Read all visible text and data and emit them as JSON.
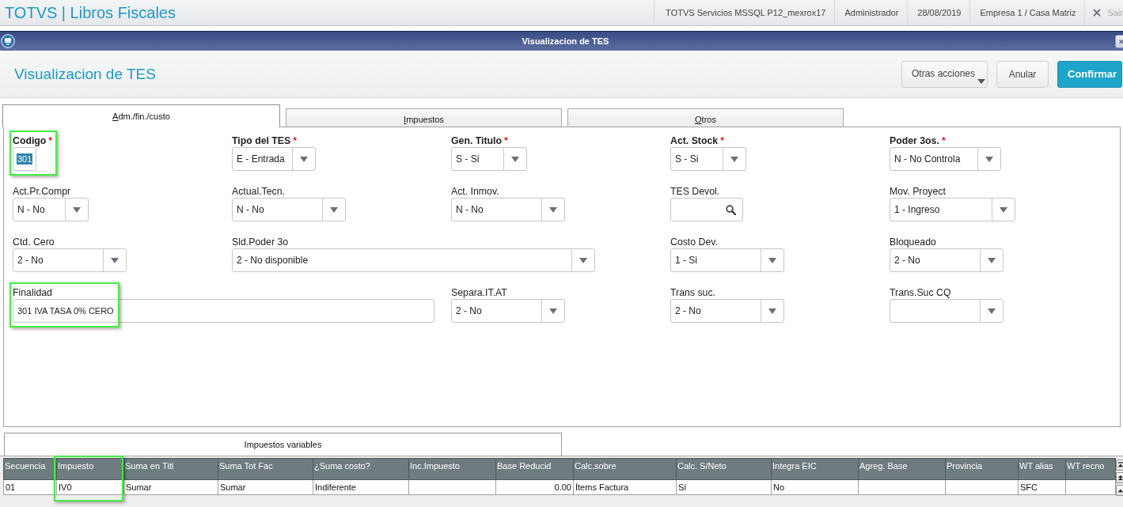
{
  "top_bar": {
    "title": "TOTVS | Libros Fiscales",
    "info": [
      "TOTVS Servicios MSSQL P12_mexrox17",
      "Administrador",
      "28/08/2019",
      "Empresa 1 / Casa Matriz"
    ],
    "logout": "Sair"
  },
  "dialog": {
    "title": "Visualizacion de TES",
    "heading": "Visualizacion de TES",
    "actions": [
      {
        "kind": "menu",
        "label": "Otras acciones"
      },
      {
        "kind": "secondary",
        "label": "Anular"
      },
      {
        "kind": "primary",
        "label": "Confirmar"
      }
    ]
  },
  "tabs": [
    {
      "label": "Adm./fin./custo",
      "selected": true
    },
    {
      "label": "Impuestos",
      "selected": false
    },
    {
      "label": "Otros",
      "selected": false
    }
  ],
  "form": {
    "required_mark": "*",
    "fields": [
      {
        "kind": "text",
        "label": "Codigo",
        "required": true,
        "value": "301",
        "value_selected": true,
        "annotated": true
      },
      {
        "kind": "select",
        "label": "Tipo del TES",
        "required": true,
        "value": "E - Entrada",
        "annotated": false
      },
      {
        "kind": "select",
        "label": "Gen. Titulo",
        "required": true,
        "value": "S - Si",
        "annotated": false
      },
      {
        "kind": "select",
        "label": "Act. Stock",
        "required": true,
        "value": "S - Si",
        "annotated": false
      },
      {
        "kind": "select",
        "label": "Poder 3os.",
        "required": true,
        "value": "N - No Controla",
        "annotated": false
      },
      {
        "kind": "select",
        "label": "Act.Pr.Compr",
        "required": false,
        "value": "N - No",
        "annotated": false
      },
      {
        "kind": "select",
        "label": "Actual.Tecn.",
        "required": false,
        "value": "N - No",
        "annotated": false
      },
      {
        "kind": "select",
        "label": "Act. Inmov.",
        "required": false,
        "value": "N - No",
        "annotated": false
      },
      {
        "kind": "search",
        "label": "TES Devol.",
        "required": false,
        "annotated": false
      },
      {
        "kind": "select",
        "label": "Mov. Proyect",
        "required": false,
        "value": "1 - Ingreso",
        "annotated": false
      },
      {
        "kind": "select",
        "label": "Ctd. Cero",
        "required": false,
        "value": "2 - No",
        "annotated": false
      },
      {
        "kind": "select",
        "label": "Sld.Poder 3o",
        "required": false,
        "value": "2 - No disponible",
        "annotated": false
      },
      {
        "kind": "select",
        "label": "Costo Dev.",
        "required": false,
        "value": "1 - Si",
        "annotated": false
      },
      {
        "kind": "select",
        "label": "Bloqueado",
        "required": false,
        "value": "2 - No",
        "annotated": false
      },
      {
        "kind": "text",
        "label": "Finalidad",
        "required": false,
        "value": "301 IVA TASA 0% CERO",
        "value_selected": false,
        "annotated": true
      },
      {
        "kind": "select",
        "label": "Separa.IT.AT",
        "required": false,
        "value": "2 - No",
        "annotated": false
      },
      {
        "kind": "select",
        "label": "Trans suc.",
        "required": false,
        "value": "2 - No",
        "annotated": false
      },
      {
        "kind": "select",
        "label": "Trans.Suc CQ",
        "required": false,
        "annotated": false
      }
    ]
  },
  "grid": {
    "title": "Impuestos variables",
    "columns": [
      {
        "label": "Secuencia",
        "highlighted": false
      },
      {
        "label": "Impuesto",
        "highlighted": true
      },
      {
        "label": "Suma en Titl",
        "highlighted": false
      },
      {
        "label": "Suma Tot Fac",
        "highlighted": false
      },
      {
        "label": "¿Suma costo?",
        "highlighted": false
      },
      {
        "label": "Inc.Impuesto",
        "highlighted": false
      },
      {
        "label": "Base Reducid",
        "highlighted": false
      },
      {
        "label": "Calc.sobre",
        "highlighted": false
      },
      {
        "label": "Calc. S/Neto",
        "highlighted": false
      },
      {
        "label": "Integra EIC",
        "highlighted": false
      },
      {
        "label": "Agreg. Base",
        "highlighted": false
      },
      {
        "label": "Provincia",
        "highlighted": false
      },
      {
        "label": "WT alias",
        "highlighted": false
      },
      {
        "label": "WT recno",
        "highlighted": false
      }
    ],
    "rows": [
      {
        "cells": [
          "01",
          "IV0",
          "Sumar",
          "Sumar",
          "Indiferente",
          null,
          "0.00",
          "Ítems Factura",
          "Sí",
          "No",
          null,
          null,
          "SFC",
          null
        ]
      }
    ]
  }
}
